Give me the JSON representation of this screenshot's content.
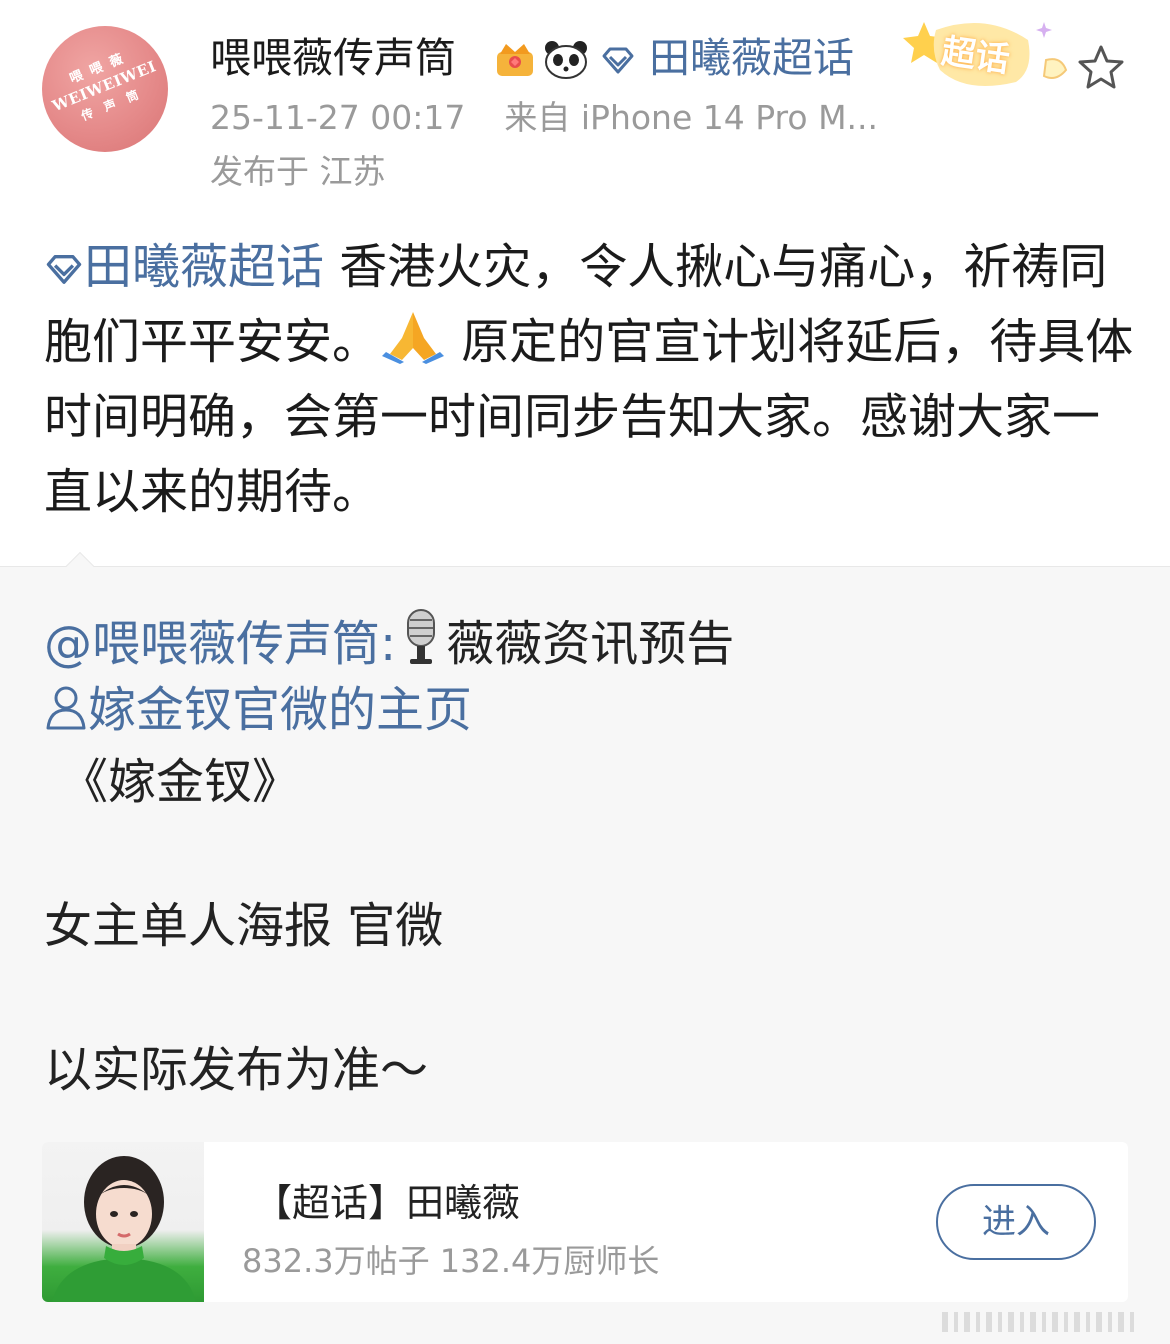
{
  "post": {
    "username": "喂喂薇传声筒",
    "supertopic_head": "田曦薇超话",
    "timestamp": "25-11-27 00:17",
    "source": "来自 iPhone 14 Pro M...",
    "location": "发布于 江苏",
    "sticker_text": "超话",
    "avatar": {
      "line1": "喂 喂 薇",
      "line2": "WEIWEIWEI",
      "line3": "传 声 筒"
    },
    "body": {
      "topic": "田曦薇超话",
      "text1": " 香港火灾，令人揪心与痛心，祈祷同胞们平平安安。",
      "text2": " 原定的官宣计划将延后，待具体时间明确，会第一时间同步告知大家。感谢大家一直以来的期待。"
    }
  },
  "repost": {
    "mention": "@喂喂薇传声筒:",
    "title_text": "薇薇资讯预告",
    "homepage_link": "嫁金钗官微的主页",
    "drama_title": "《嫁金钗》",
    "line_poster": "女主单人海报 官微",
    "line_note": "以实际发布为准～"
  },
  "card": {
    "title": "【超话】田曦薇",
    "stats": "832.3万帖子 132.4万厨师长",
    "enter_label": "进入"
  },
  "colors": {
    "link": "#4a6fa0",
    "text": "#1b1b1b",
    "meta": "#9a9a9a",
    "repost_bg": "#f7f7f7"
  },
  "icons": [
    "crown-badge-icon",
    "panda-icon",
    "diamond-supertopic-icon",
    "star-favorite-icon",
    "folded-hands-emoji",
    "microphone-emoji",
    "person-icon"
  ]
}
